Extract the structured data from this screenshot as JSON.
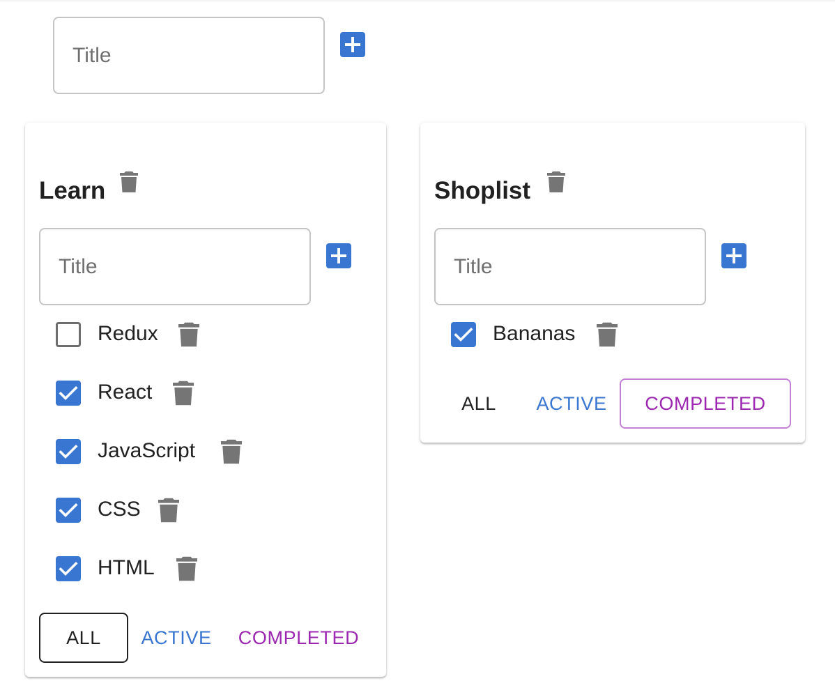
{
  "new_list": {
    "placeholder": "Title"
  },
  "lists": [
    {
      "title": "Learn",
      "input_placeholder": "Title",
      "tasks": [
        {
          "label": "Redux",
          "done": false
        },
        {
          "label": "React",
          "done": true
        },
        {
          "label": "JavaScript",
          "done": true
        },
        {
          "label": "CSS",
          "done": true
        },
        {
          "label": "HTML",
          "done": true
        }
      ],
      "filters": {
        "all": "ALL",
        "active": "ACTIVE",
        "completed": "COMPLETED",
        "selected": "all"
      }
    },
    {
      "title": "Shoplist",
      "input_placeholder": "Title",
      "tasks": [
        {
          "label": "Bananas",
          "done": true
        }
      ],
      "filters": {
        "all": "ALL",
        "active": "ACTIVE",
        "completed": "COMPLETED",
        "selected": "completed"
      }
    }
  ],
  "icons": {
    "add": "plus-icon",
    "delete": "trash-icon",
    "checkbox_checked": "check-icon"
  },
  "colors": {
    "primary": "#3876d1",
    "secondary": "#9c27b0",
    "icon_gray": "#757575"
  }
}
